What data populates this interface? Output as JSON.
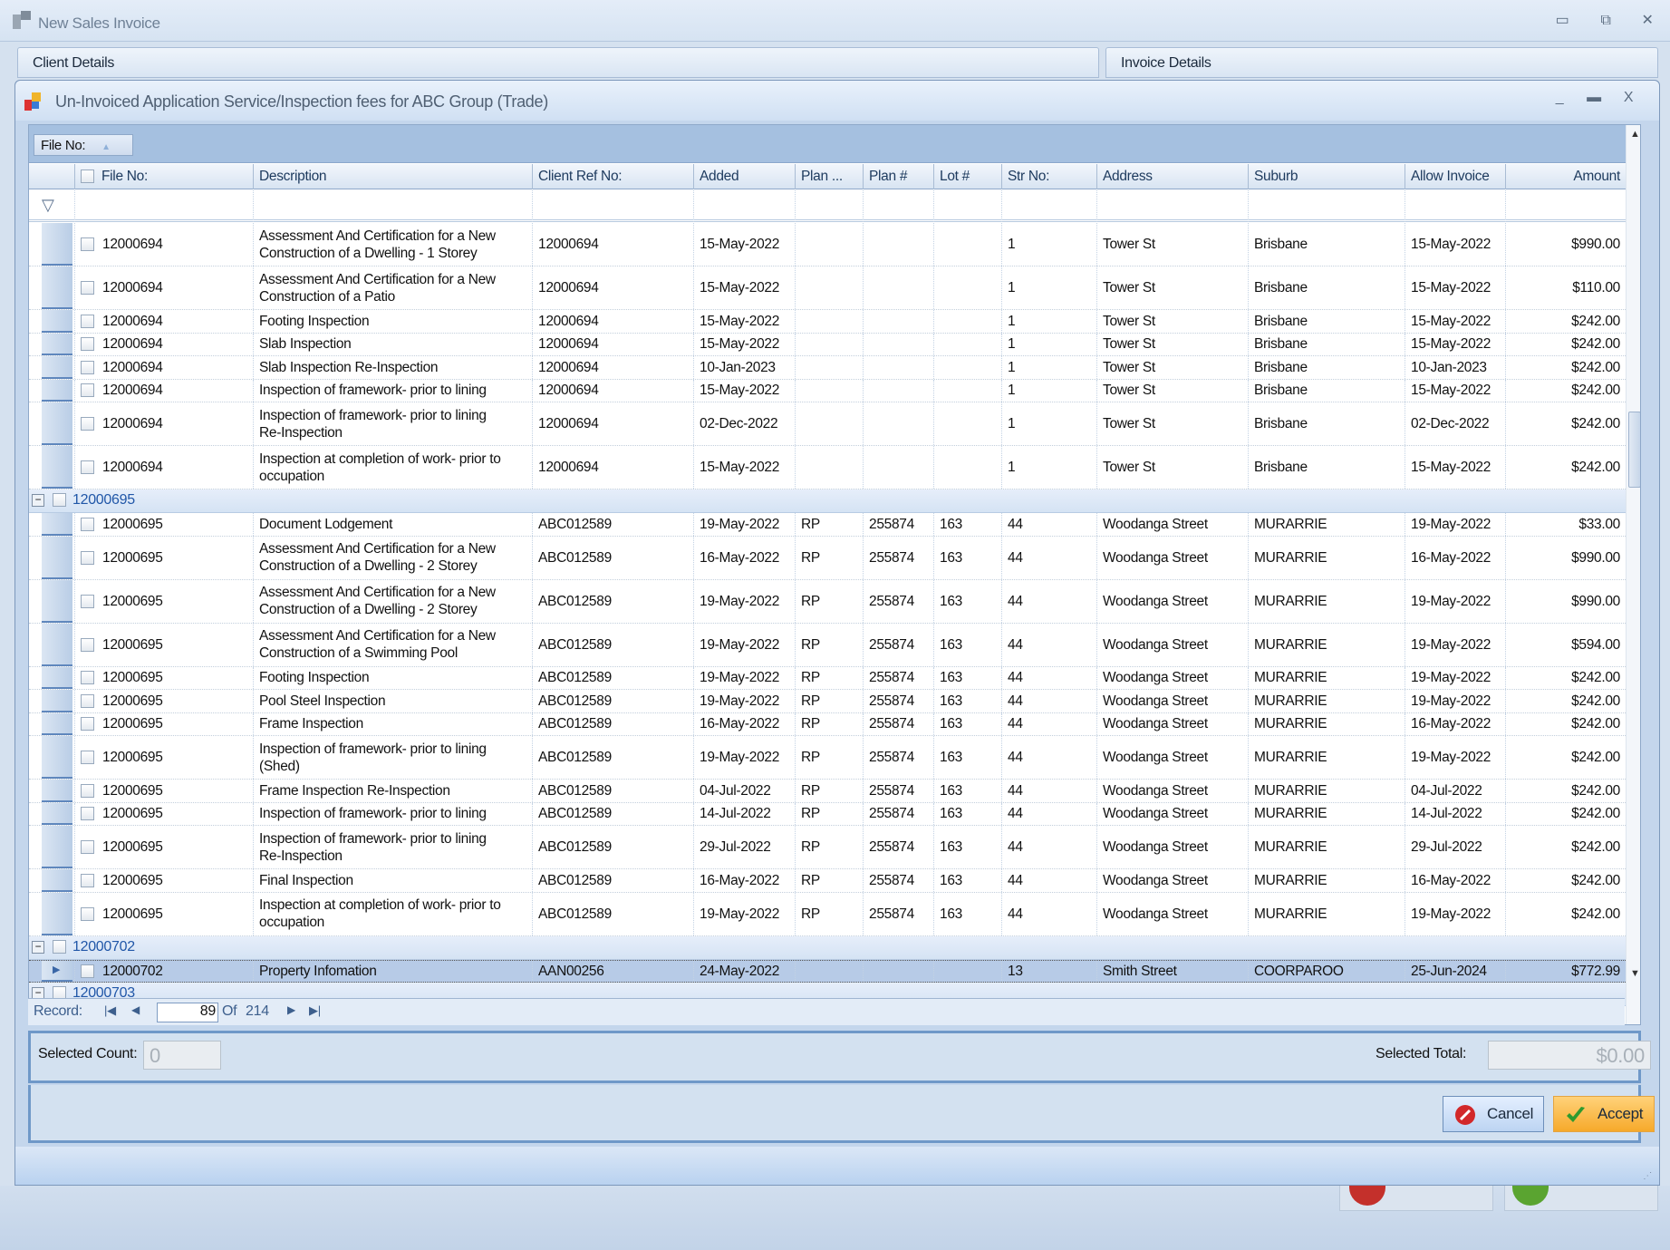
{
  "window": {
    "title": "New Sales Invoice"
  },
  "tabs": [
    {
      "label": "Client Details"
    },
    {
      "label": "Invoice Details"
    }
  ],
  "dialog": {
    "title": "Un-Invoiced Application Service/Inspection fees for ABC Group (Trade)"
  },
  "group_panel": {
    "chip": "File No:"
  },
  "columns": [
    "File No:",
    "Description",
    "Client Ref No:",
    "Added",
    "Plan ...",
    "Plan #",
    "Lot #",
    "Str No:",
    "Address",
    "Suburb",
    "Allow Invoice",
    "Amount"
  ],
  "rows": [
    {
      "type": "item",
      "file": "12000694",
      "desc": "Assessment And Certification for a New\nConstruction of a Dwelling - 1 Storey",
      "ref": "12000694",
      "added": "15-May-2022",
      "plan": "",
      "plannum": "",
      "lot": "",
      "str": "1",
      "addr": "Tower St",
      "suburb": "Brisbane",
      "allow": "15-May-2022",
      "amount": "$990.00"
    },
    {
      "type": "item",
      "file": "12000694",
      "desc": "Assessment And Certification for a New\nConstruction of a Patio",
      "ref": "12000694",
      "added": "15-May-2022",
      "plan": "",
      "plannum": "",
      "lot": "",
      "str": "1",
      "addr": "Tower St",
      "suburb": "Brisbane",
      "allow": "15-May-2022",
      "amount": "$110.00"
    },
    {
      "type": "item",
      "file": "12000694",
      "desc": "Footing Inspection",
      "ref": "12000694",
      "added": "15-May-2022",
      "plan": "",
      "plannum": "",
      "lot": "",
      "str": "1",
      "addr": "Tower St",
      "suburb": "Brisbane",
      "allow": "15-May-2022",
      "amount": "$242.00"
    },
    {
      "type": "item",
      "file": "12000694",
      "desc": "Slab Inspection",
      "ref": "12000694",
      "added": "15-May-2022",
      "plan": "",
      "plannum": "",
      "lot": "",
      "str": "1",
      "addr": "Tower St",
      "suburb": "Brisbane",
      "allow": "15-May-2022",
      "amount": "$242.00"
    },
    {
      "type": "item",
      "file": "12000694",
      "desc": "Slab Inspection Re-Inspection",
      "ref": "12000694",
      "added": "10-Jan-2023",
      "plan": "",
      "plannum": "",
      "lot": "",
      "str": "1",
      "addr": "Tower St",
      "suburb": "Brisbane",
      "allow": "10-Jan-2023",
      "amount": "$242.00"
    },
    {
      "type": "item",
      "file": "12000694",
      "desc": "Inspection of framework- prior to lining",
      "ref": "12000694",
      "added": "15-May-2022",
      "plan": "",
      "plannum": "",
      "lot": "",
      "str": "1",
      "addr": "Tower St",
      "suburb": "Brisbane",
      "allow": "15-May-2022",
      "amount": "$242.00"
    },
    {
      "type": "item",
      "file": "12000694",
      "desc": "Inspection of framework- prior to lining\nRe-Inspection",
      "ref": "12000694",
      "added": "02-Dec-2022",
      "plan": "",
      "plannum": "",
      "lot": "",
      "str": "1",
      "addr": "Tower St",
      "suburb": "Brisbane",
      "allow": "02-Dec-2022",
      "amount": "$242.00"
    },
    {
      "type": "item",
      "file": "12000694",
      "desc": "Inspection at completion of work- prior to\noccupation",
      "ref": "12000694",
      "added": "15-May-2022",
      "plan": "",
      "plannum": "",
      "lot": "",
      "str": "1",
      "addr": "Tower St",
      "suburb": "Brisbane",
      "allow": "15-May-2022",
      "amount": "$242.00"
    },
    {
      "type": "group",
      "label": "12000695"
    },
    {
      "type": "item",
      "file": "12000695",
      "desc": "Document Lodgement",
      "ref": "ABC012589",
      "added": "19-May-2022",
      "plan": "RP",
      "plannum": "255874",
      "lot": "163",
      "str": "44",
      "addr": "Woodanga Street",
      "suburb": "MURARRIE",
      "allow": "19-May-2022",
      "amount": "$33.00"
    },
    {
      "type": "item",
      "file": "12000695",
      "desc": "Assessment And Certification for a New\nConstruction of a Dwelling - 2 Storey",
      "ref": "ABC012589",
      "added": "16-May-2022",
      "plan": "RP",
      "plannum": "255874",
      "lot": "163",
      "str": "44",
      "addr": "Woodanga Street",
      "suburb": "MURARRIE",
      "allow": "16-May-2022",
      "amount": "$990.00"
    },
    {
      "type": "item",
      "file": "12000695",
      "desc": "Assessment And Certification for a New\nConstruction of a Dwelling - 2 Storey",
      "ref": "ABC012589",
      "added": "19-May-2022",
      "plan": "RP",
      "plannum": "255874",
      "lot": "163",
      "str": "44",
      "addr": "Woodanga Street",
      "suburb": "MURARRIE",
      "allow": "19-May-2022",
      "amount": "$990.00"
    },
    {
      "type": "item",
      "file": "12000695",
      "desc": "Assessment And Certification for a New\nConstruction of a Swimming Pool",
      "ref": "ABC012589",
      "added": "19-May-2022",
      "plan": "RP",
      "plannum": "255874",
      "lot": "163",
      "str": "44",
      "addr": "Woodanga Street",
      "suburb": "MURARRIE",
      "allow": "19-May-2022",
      "amount": "$594.00"
    },
    {
      "type": "item",
      "file": "12000695",
      "desc": "Footing Inspection",
      "ref": "ABC012589",
      "added": "19-May-2022",
      "plan": "RP",
      "plannum": "255874",
      "lot": "163",
      "str": "44",
      "addr": "Woodanga Street",
      "suburb": "MURARRIE",
      "allow": "19-May-2022",
      "amount": "$242.00"
    },
    {
      "type": "item",
      "file": "12000695",
      "desc": "Pool Steel Inspection",
      "ref": "ABC012589",
      "added": "19-May-2022",
      "plan": "RP",
      "plannum": "255874",
      "lot": "163",
      "str": "44",
      "addr": "Woodanga Street",
      "suburb": "MURARRIE",
      "allow": "19-May-2022",
      "amount": "$242.00"
    },
    {
      "type": "item",
      "file": "12000695",
      "desc": "Frame Inspection",
      "ref": "ABC012589",
      "added": "16-May-2022",
      "plan": "RP",
      "plannum": "255874",
      "lot": "163",
      "str": "44",
      "addr": "Woodanga Street",
      "suburb": "MURARRIE",
      "allow": "16-May-2022",
      "amount": "$242.00"
    },
    {
      "type": "item",
      "file": "12000695",
      "desc": "Inspection of framework- prior to lining\n(Shed)",
      "ref": "ABC012589",
      "added": "19-May-2022",
      "plan": "RP",
      "plannum": "255874",
      "lot": "163",
      "str": "44",
      "addr": "Woodanga Street",
      "suburb": "MURARRIE",
      "allow": "19-May-2022",
      "amount": "$242.00"
    },
    {
      "type": "item",
      "file": "12000695",
      "desc": "Frame Inspection Re-Inspection",
      "ref": "ABC012589",
      "added": "04-Jul-2022",
      "plan": "RP",
      "plannum": "255874",
      "lot": "163",
      "str": "44",
      "addr": "Woodanga Street",
      "suburb": "MURARRIE",
      "allow": "04-Jul-2022",
      "amount": "$242.00"
    },
    {
      "type": "item",
      "file": "12000695",
      "desc": "Inspection of framework- prior to lining",
      "ref": "ABC012589",
      "added": "14-Jul-2022",
      "plan": "RP",
      "plannum": "255874",
      "lot": "163",
      "str": "44",
      "addr": "Woodanga Street",
      "suburb": "MURARRIE",
      "allow": "14-Jul-2022",
      "amount": "$242.00"
    },
    {
      "type": "item",
      "file": "12000695",
      "desc": "Inspection of framework- prior to lining\nRe-Inspection",
      "ref": "ABC012589",
      "added": "29-Jul-2022",
      "plan": "RP",
      "plannum": "255874",
      "lot": "163",
      "str": "44",
      "addr": "Woodanga Street",
      "suburb": "MURARRIE",
      "allow": "29-Jul-2022",
      "amount": "$242.00"
    },
    {
      "type": "item",
      "file": "12000695",
      "desc": "Final Inspection",
      "ref": "ABC012589",
      "added": "16-May-2022",
      "plan": "RP",
      "plannum": "255874",
      "lot": "163",
      "str": "44",
      "addr": "Woodanga Street",
      "suburb": "MURARRIE",
      "allow": "16-May-2022",
      "amount": "$242.00"
    },
    {
      "type": "item",
      "file": "12000695",
      "desc": "Inspection at completion of work- prior to\noccupation",
      "ref": "ABC012589",
      "added": "19-May-2022",
      "plan": "RP",
      "plannum": "255874",
      "lot": "163",
      "str": "44",
      "addr": "Woodanga Street",
      "suburb": "MURARRIE",
      "allow": "19-May-2022",
      "amount": "$242.00"
    },
    {
      "type": "group",
      "label": "12000702"
    },
    {
      "type": "item",
      "selected": true,
      "file": "12000702",
      "desc": "Property Infomation",
      "ref": "AAN00256",
      "added": "24-May-2022",
      "plan": "",
      "plannum": "",
      "lot": "",
      "str": "13",
      "addr": "Smith Street",
      "suburb": "COORPAROO",
      "allow": "25-Jun-2024",
      "amount": "$772.99"
    },
    {
      "type": "group",
      "label": "12000703"
    }
  ],
  "navigator": {
    "label": "Record:",
    "current": "89",
    "of_label": "Of",
    "total": "214"
  },
  "summary": {
    "count_label": "Selected Count:",
    "count_value": "0",
    "total_label": "Selected Total:",
    "total_value": "$0.00"
  },
  "buttons": {
    "cancel": "Cancel",
    "accept": "Accept"
  },
  "colors": {
    "accent": "#6f98c8",
    "group_text": "#2157a8",
    "accept": "#f6a92a"
  }
}
